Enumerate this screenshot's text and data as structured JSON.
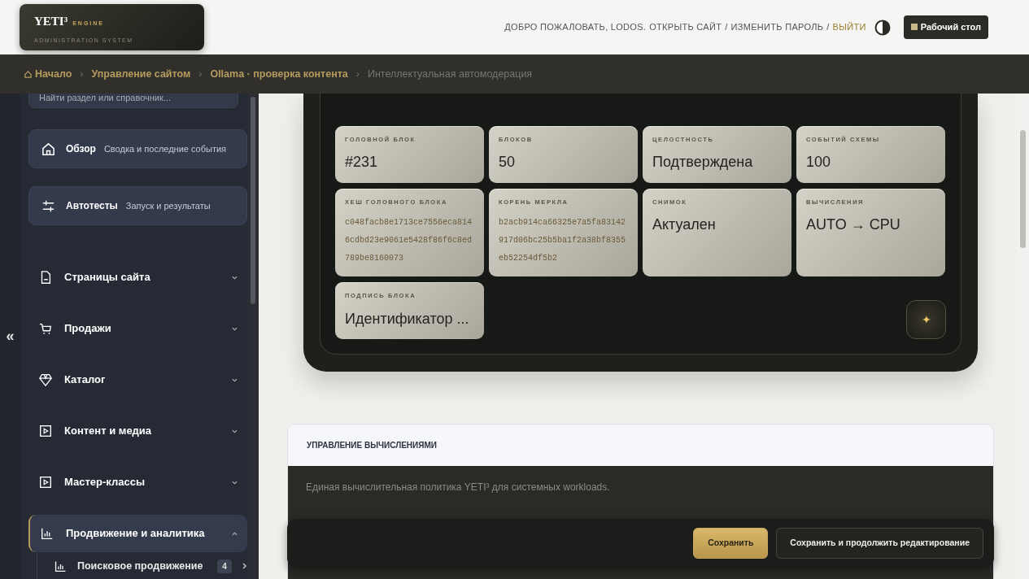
{
  "header": {
    "logo": "YETI³",
    "logo_suffix": "ENGINE",
    "logo_subtitle": "ADMINISTRATION SYSTEM",
    "user_links": [
      {
        "kind": "text",
        "text": "ДОБРО ПОЖАЛОВАТЬ, LODOS."
      },
      {
        "kind": "link",
        "text": "ОТКРЫТЬ САЙТ"
      },
      {
        "kind": "separator",
        "text": "/"
      },
      {
        "kind": "link",
        "text": "ИЗМЕНИТЬ ПАРОЛЬ"
      },
      {
        "kind": "separator",
        "text": "/"
      },
      {
        "kind": "logout",
        "text": "ВЫЙТИ"
      }
    ],
    "desktop_button": "Рабочий стол"
  },
  "breadcrumbs": [
    {
      "label": "Начало",
      "current": false
    },
    {
      "label": "Управление сайтом",
      "current": false
    },
    {
      "label": "Ollama · проверка контента",
      "current": false
    },
    {
      "label": "Интеллектуальная автомодерация",
      "current": true
    }
  ],
  "breadcrumb_separator": "›",
  "sidebar": {
    "collapse_glyph": "«",
    "search": {
      "placeholder": "Найти раздел или справочник..."
    },
    "quick_links": [
      {
        "kind": "home",
        "title": "Обзор",
        "subtitle": "Сводка и последние события"
      },
      {
        "kind": "sliders",
        "title": "Автотесты",
        "subtitle": "Запуск и результаты"
      }
    ],
    "items": [
      {
        "kind": "file",
        "label": "Страницы сайта",
        "expanded": false,
        "selected": false
      },
      {
        "kind": "cart",
        "label": "Продажи",
        "expanded": false,
        "selected": false
      },
      {
        "kind": "diamond",
        "label": "Каталог",
        "expanded": false,
        "selected": false
      },
      {
        "kind": "play",
        "label": "Контент и медиа",
        "expanded": false,
        "selected": false
      },
      {
        "kind": "play",
        "label": "Мастер-классы",
        "expanded": false,
        "selected": false
      },
      {
        "kind": "chart",
        "label": "Продвижение и аналитика",
        "expanded": true,
        "selected": true,
        "children": [
          {
            "kind": "chart",
            "label": "Поисковое продвижение",
            "badge": "4"
          }
        ]
      }
    ]
  },
  "stats": [
    {
      "kind": "text",
      "label": "ГОЛОВНОЙ БЛОК",
      "value": "#231"
    },
    {
      "kind": "text",
      "label": "БЛОКОВ",
      "value": "50"
    },
    {
      "kind": "text",
      "label": "ЦЕЛОСТНОСТЬ",
      "value": "Подтверждена"
    },
    {
      "kind": "text",
      "label": "СОБЫТИЙ СХЕМЫ",
      "value": "100"
    },
    {
      "kind": "hash",
      "label": "ХЕШ ГОЛОВНОГО БЛОКА",
      "value": "c048facb8e1713ce7556eca8146cdbd23e9061e5428f86f6c8ed789be8160073"
    },
    {
      "kind": "hash",
      "label": "КОРЕНЬ МЕРКЛА",
      "value": "b2acb914ca66325e7a5fa83142917d06bc25b5ba1f2a38bf8355eb52254df5b2"
    },
    {
      "kind": "text",
      "label": "СНИМОК",
      "value": "Актуален"
    },
    {
      "kind": "text",
      "label": "ВЫЧИСЛЕНИЯ",
      "value": "AUTO → CPU"
    },
    {
      "kind": "text",
      "label": "ПОДПИСЬ БЛОКА",
      "value": "Идентификатор ..."
    }
  ],
  "sparkle_button": "✦",
  "compute": {
    "title": "УПРАВЛЕНИЕ ВЫЧИСЛЕНИЯМИ",
    "description": "Единая вычислительная политика YETI³ для системных workloads."
  },
  "save_bar": [
    {
      "label": "Сохранить",
      "primary": true
    },
    {
      "label": "Сохранить и продолжить редактирование",
      "primary": false
    }
  ]
}
